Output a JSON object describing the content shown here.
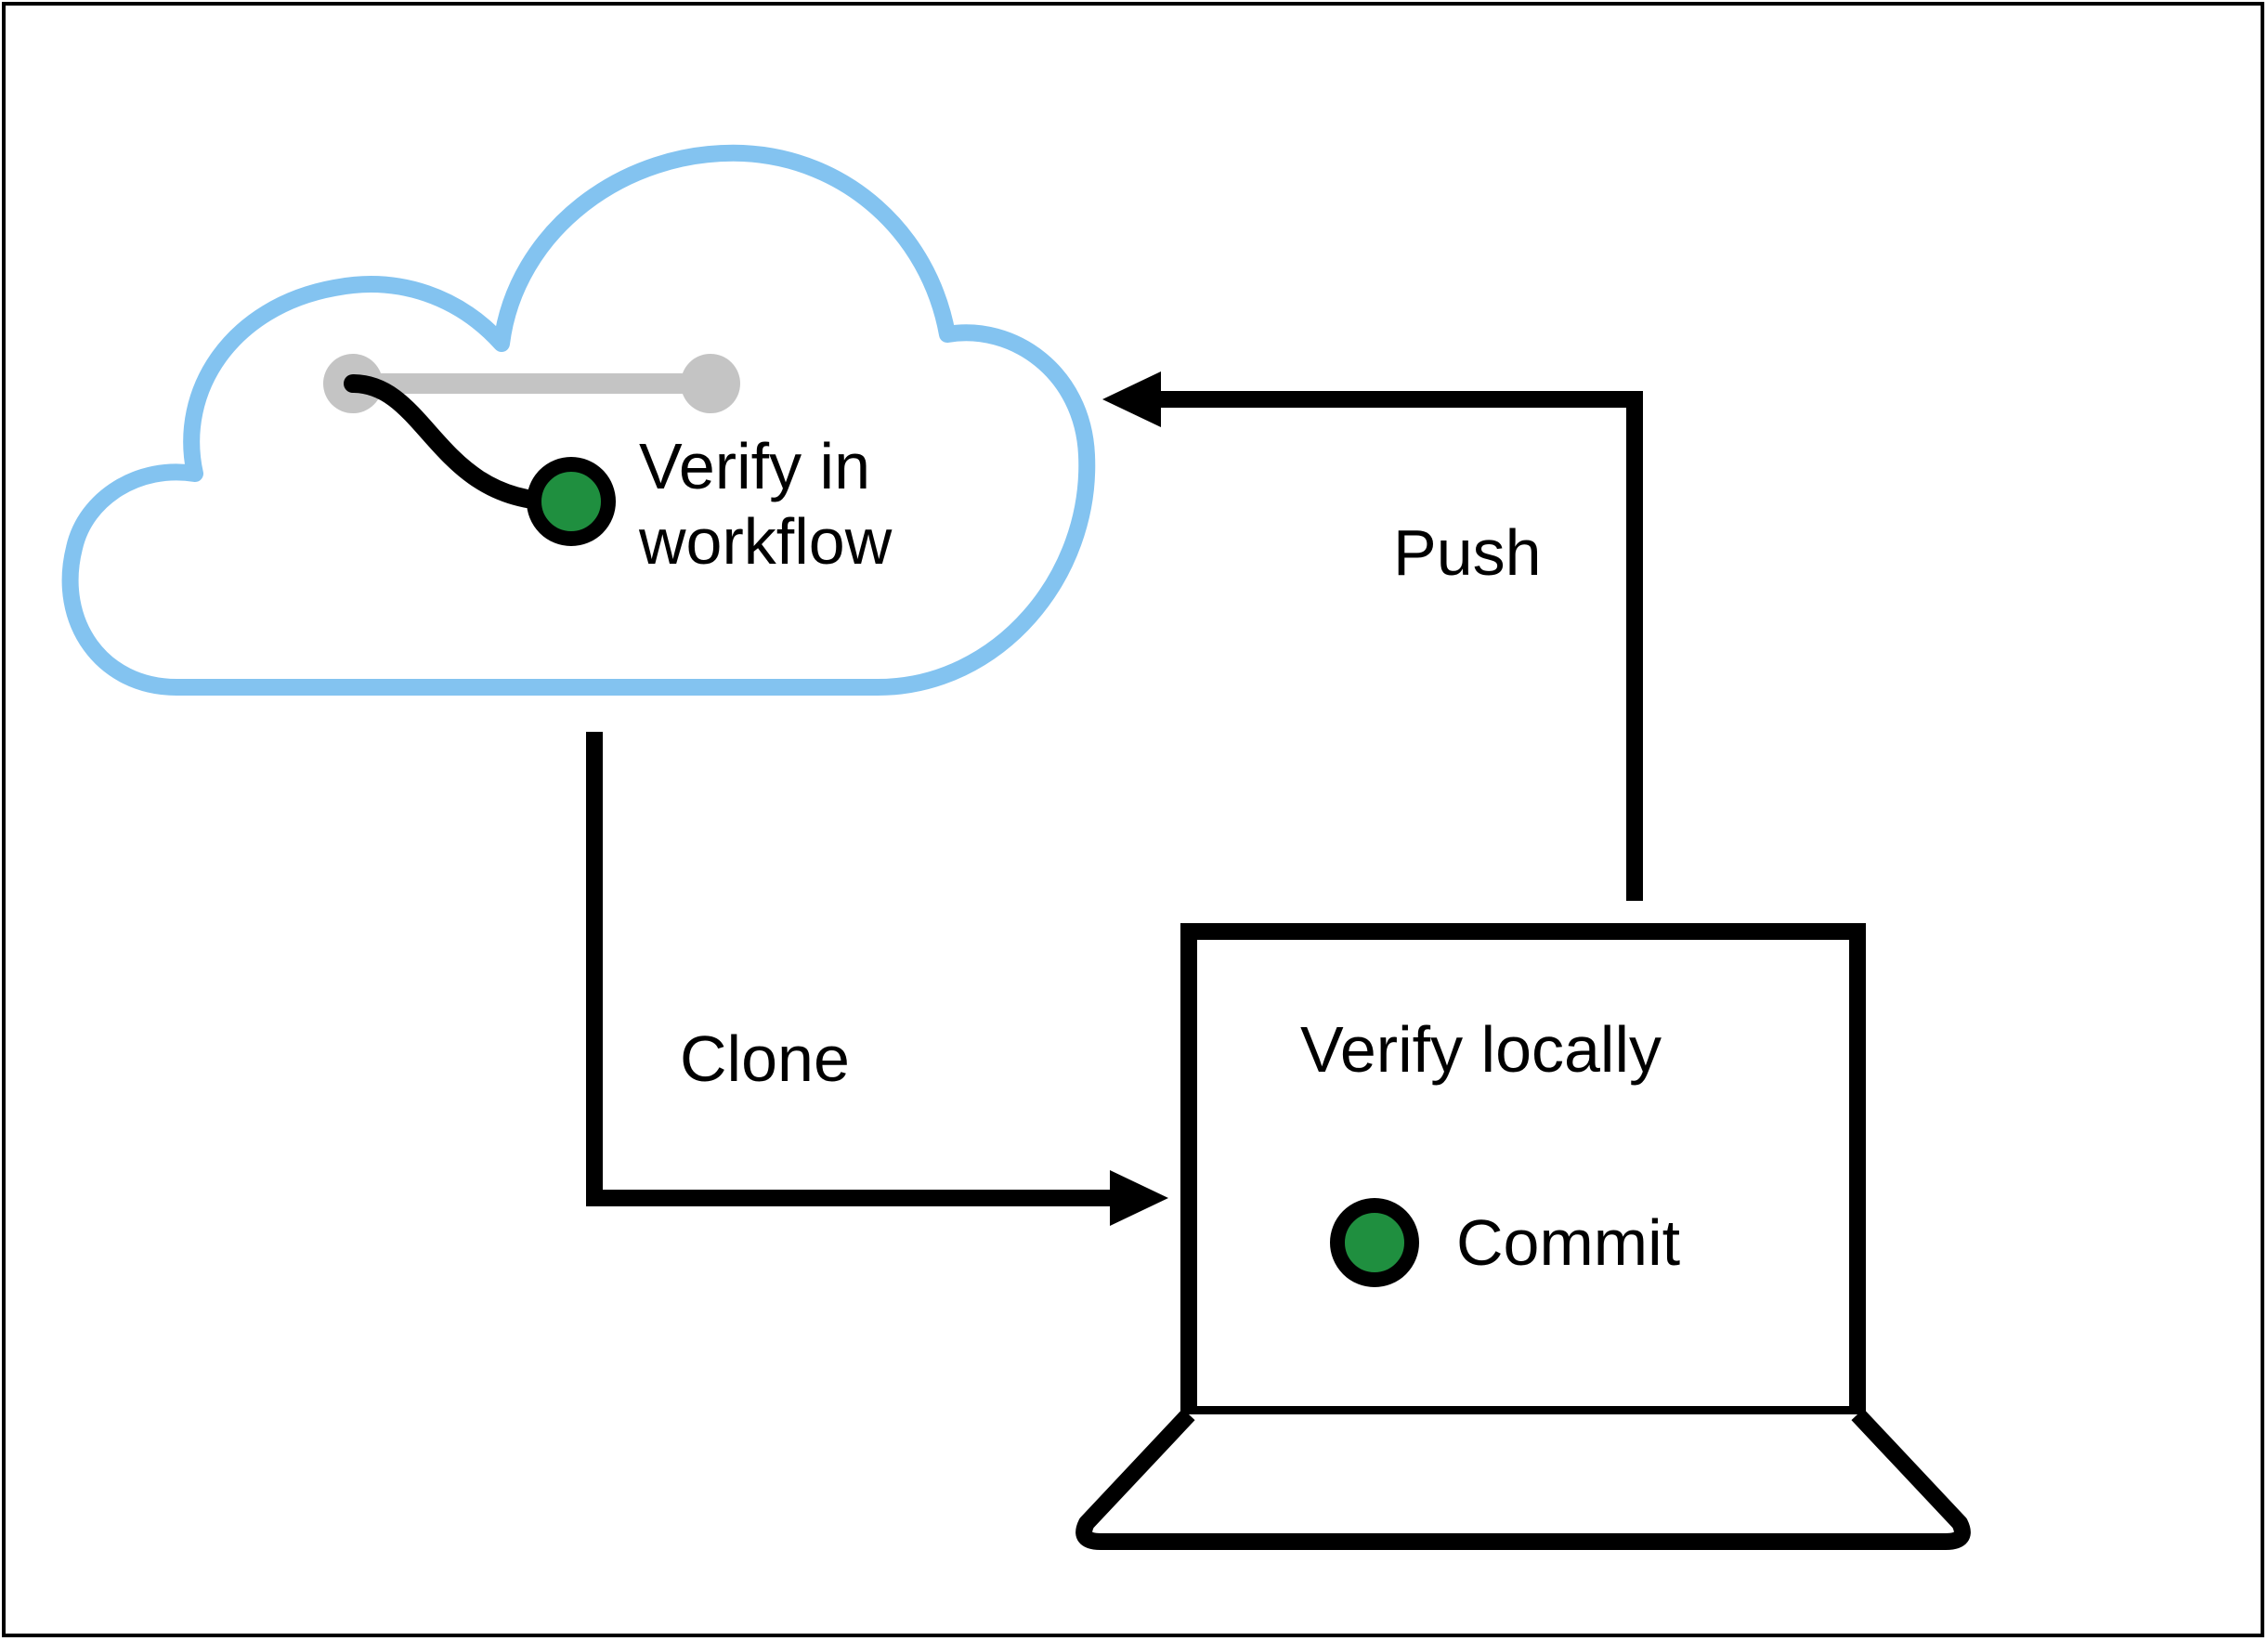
{
  "diagram": {
    "cloud_label_line1": "Verify in",
    "cloud_label_line2": "workflow",
    "clone_label": "Clone",
    "push_label": "Push",
    "laptop_top_label": "Verify locally",
    "laptop_bottom_label": "Commit",
    "colors": {
      "cloud_stroke": "#83c3f0",
      "branch_gray": "#c4c4c4",
      "commit_green": "#1f8f3f",
      "black": "#000000",
      "white": "#ffffff"
    }
  }
}
